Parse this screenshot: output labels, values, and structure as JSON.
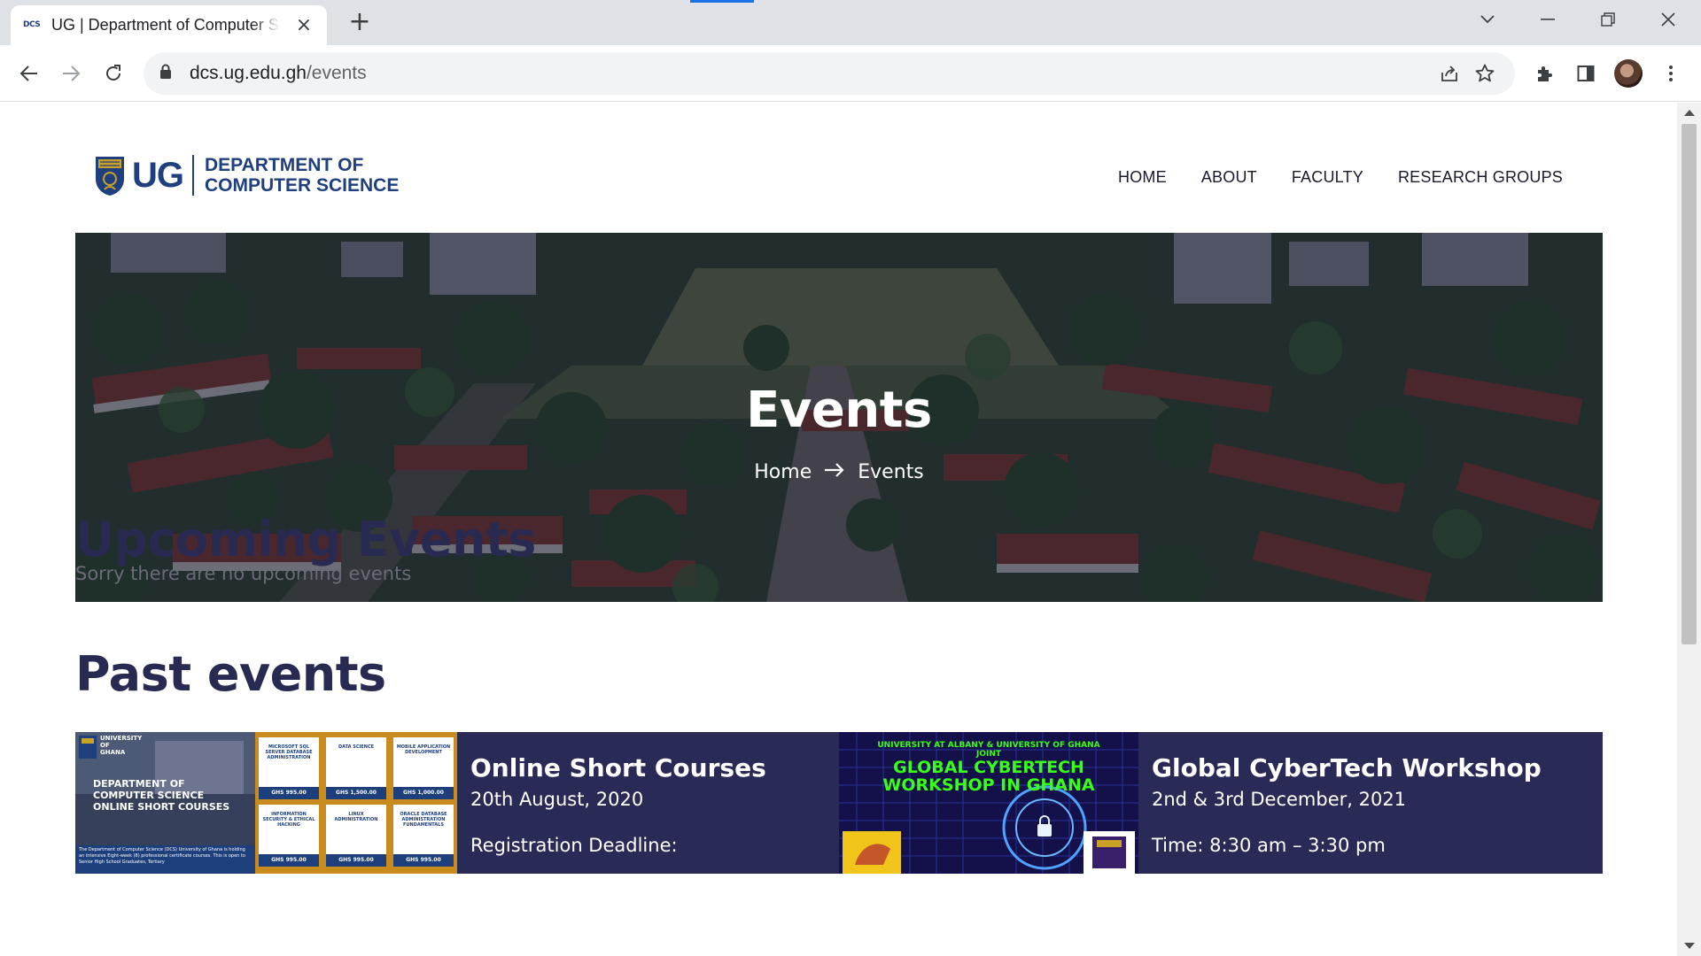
{
  "browser": {
    "tab_title": "UG | Department of Computer Science",
    "favicon_text": "DCS",
    "url_host": "dcs.ug.edu.gh",
    "url_path": "/events"
  },
  "site": {
    "logo_short": "UG",
    "logo_line1": "DEPARTMENT OF",
    "logo_line2": "COMPUTER SCIENCE",
    "nav": [
      "HOME",
      "ABOUT",
      "FACULTY",
      "RESEARCH GROUPS"
    ]
  },
  "hero": {
    "title": "Events",
    "breadcrumb_home": "Home",
    "breadcrumb_current": "Events"
  },
  "upcoming": {
    "heading": "Upcoming Events",
    "empty_message": "Sorry there are no upcoming events"
  },
  "past": {
    "heading": "Past events",
    "events": [
      {
        "title": "Online Short Courses",
        "date": "20th August, 2020",
        "snippet": "Registration Deadline:",
        "poster": {
          "university": "UNIVERSITY OF GHANA",
          "headline_1": "DEPARTMENT OF",
          "headline_2": "COMPUTER SCIENCE",
          "headline_3": "ONLINE SHORT COURSES",
          "blurb": "The Department of Computer Science (DCS) University of Ghana is holding an intensive Eight-week (8) professional certificate courses. This is open to Senior High School Graduates, Tertiary",
          "courses": [
            {
              "name": "MICROSOFT SQL SERVER DATABASE ADMINISTRATION",
              "price": "GHS 995.00"
            },
            {
              "name": "DATA SCIENCE",
              "price": "GHS 1,500.00"
            },
            {
              "name": "MOBILE APPLICATION DEVELOPMENT",
              "price": "GHS 1,000.00"
            },
            {
              "name": "INFORMATION SECURITY & ETHICAL HACKING",
              "price": "GHS 995.00"
            },
            {
              "name": "LINUX ADMINISTRATION",
              "price": "GHS 995.00"
            },
            {
              "name": "ORACLE DATABASE ADMINISTRATION FUNDAMENTALS",
              "price": "GHS 995.00"
            }
          ]
        }
      },
      {
        "title": "Global CyberTech Workshop",
        "date": "2nd & 3rd December, 2021",
        "snippet": "Time: 8:30 am – 3:30 pm",
        "poster": {
          "line1": "UNIVERSITY AT ALBANY & UNIVERSITY OF GHANA",
          "line2": "JOINT",
          "line3": "GLOBAL CYBERTECH",
          "line4": "WORKSHOP IN GHANA"
        }
      }
    ]
  },
  "colors": {
    "brand_navy": "#1f3f7e",
    "heading": "#292a52",
    "card_bg": "#2a2a56",
    "chrome_bg": "#dee1e6",
    "poster_green": "#39ff14"
  }
}
